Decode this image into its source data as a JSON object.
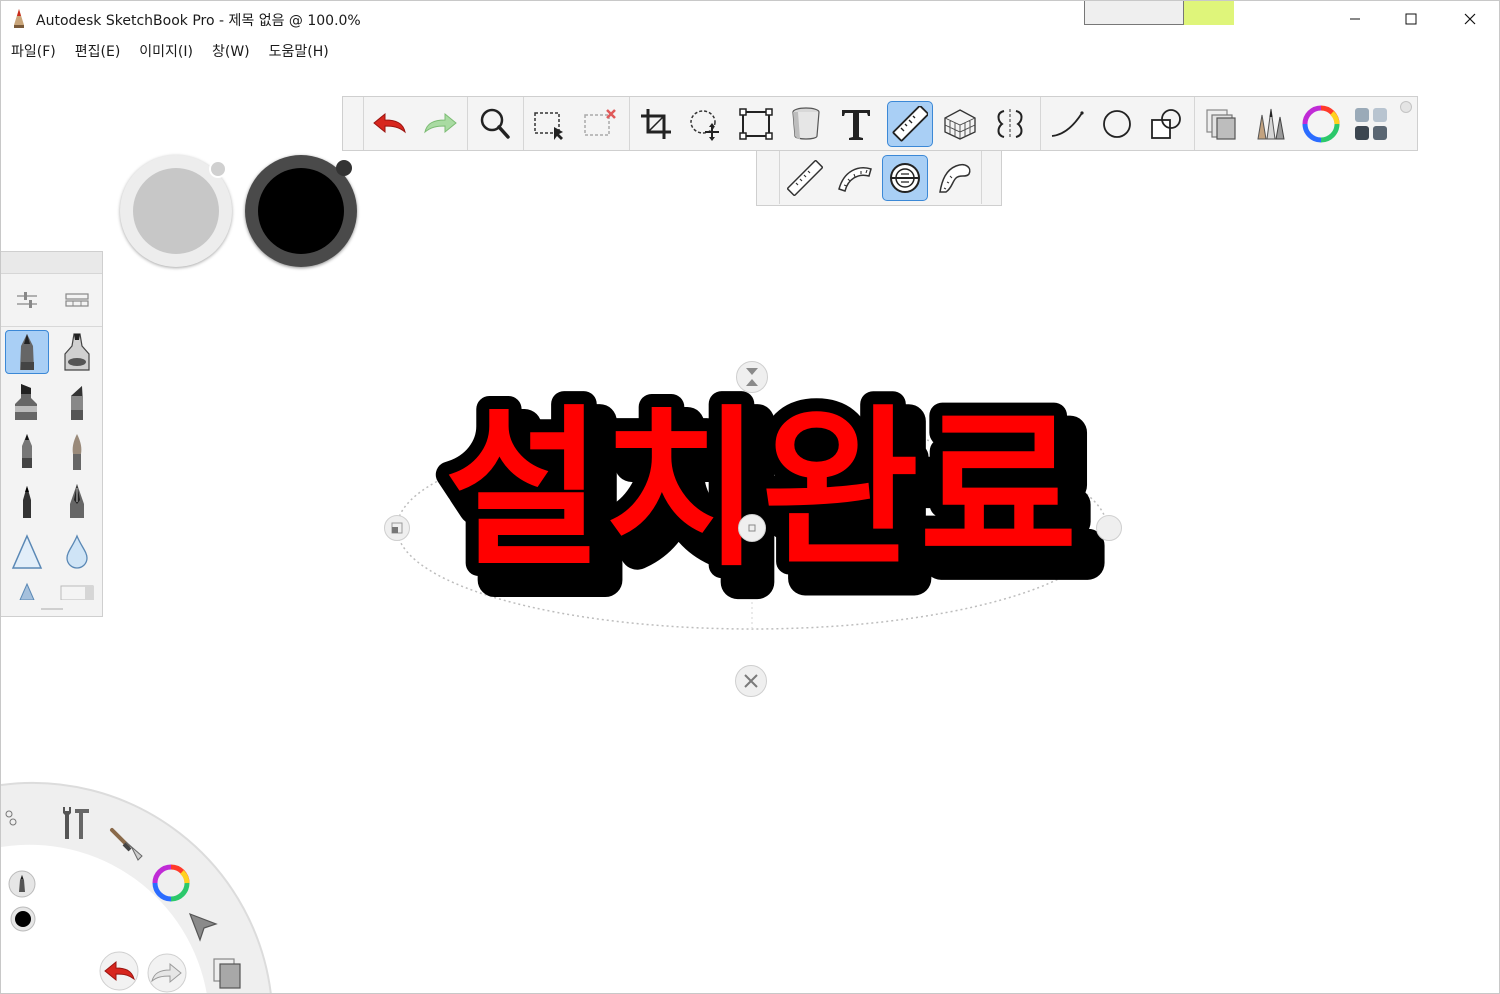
{
  "window": {
    "title": "Autodesk SketchBook Pro - 제목 없음 @ 100.0%",
    "controls": {
      "minimize": "minimize",
      "maximize": "maximize",
      "close": "close"
    }
  },
  "menu": [
    {
      "label": "파일(F)"
    },
    {
      "label": "편집(E)"
    },
    {
      "label": "이미지(I)"
    },
    {
      "label": "창(W)"
    },
    {
      "label": "도움말(H)"
    }
  ],
  "toolbar": {
    "items": [
      {
        "icon": "undo-icon"
      },
      {
        "icon": "redo-icon"
      },
      {
        "icon": "zoom-icon"
      },
      {
        "icon": "select-rectangle-icon"
      },
      {
        "icon": "clear-selection-icon"
      },
      {
        "icon": "crop-icon"
      },
      {
        "icon": "lasso-move-icon"
      },
      {
        "icon": "transform-icon"
      },
      {
        "icon": "fill-bucket-icon"
      },
      {
        "icon": "text-icon"
      },
      {
        "icon": "ruler-icon",
        "selected": true
      },
      {
        "icon": "perspective-grid-icon"
      },
      {
        "icon": "symmetry-icon"
      },
      {
        "icon": "line-icon"
      },
      {
        "icon": "ellipse-icon"
      },
      {
        "icon": "shapes-icon"
      },
      {
        "icon": "layers-icon"
      },
      {
        "icon": "brushes-icon"
      },
      {
        "icon": "color-wheel-icon"
      },
      {
        "icon": "palette-grid-icon"
      }
    ]
  },
  "ruler_tools": [
    {
      "icon": "straight-ruler-icon"
    },
    {
      "icon": "french-curve-ruler-icon"
    },
    {
      "icon": "ellipse-ruler-icon",
      "selected": true
    },
    {
      "icon": "french-curve-icon"
    }
  ],
  "colors": {
    "primary_puck": "#c7c7c7",
    "secondary_puck": "#000000",
    "accent_selected": "#a9cff5",
    "accent_border": "#3b88d6",
    "text_fill": "#ff0000",
    "text_stroke": "#000000"
  },
  "canvas": {
    "text": "설치완료"
  },
  "brush_palette": {
    "brushes": [
      "pencil-brush-icon",
      "airbrush-icon",
      "marker-icon",
      "chisel-marker-icon",
      "ballpoint-pen-icon",
      "paintbrush-icon",
      "ink-pen-icon",
      "fountain-pen-icon",
      "triangle-brush-icon",
      "water-drop-icon",
      "cone-brush-icon",
      "eraser-icon"
    ]
  },
  "lagoon": {
    "items": [
      "tools-icon",
      "brush-icon",
      "color-wheel-icon",
      "select-arrow-icon",
      "layers-icon",
      "undo-icon",
      "redo-icon",
      "pencil-indicator-icon",
      "color-indicator-icon"
    ]
  }
}
